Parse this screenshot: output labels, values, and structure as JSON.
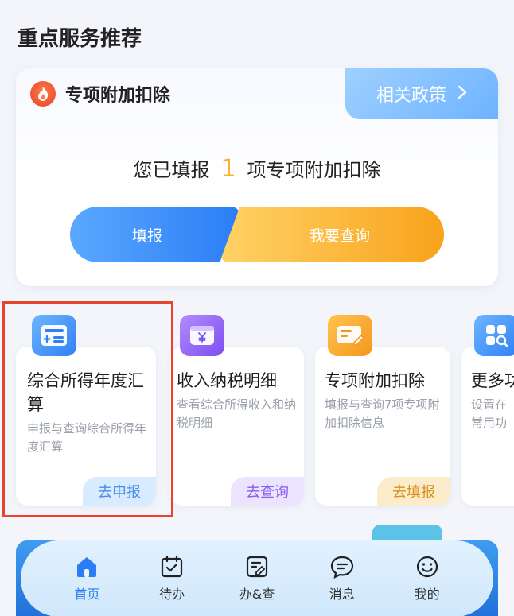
{
  "section": {
    "title": "重点服务推荐"
  },
  "deduction": {
    "title": "专项附加扣除",
    "policy_label": "相关政策",
    "filled_prefix": "您已填报",
    "filled_count": "1",
    "filled_suffix": "项专项附加扣除",
    "fill_button": "填报",
    "query_button": "我要查询"
  },
  "services": [
    {
      "title": "综合所得年度汇算",
      "desc": "申报与查询综合所得年度汇算",
      "action": "去申报",
      "icon": "tax-form-icon"
    },
    {
      "title": "收入纳税明细",
      "desc": "查看综合所得收入和纳税明细",
      "action": "去查询",
      "icon": "wallet-yen-icon"
    },
    {
      "title": "专项附加扣除",
      "desc": "填报与查询7项专项附加扣除信息",
      "action": "去填报",
      "icon": "card-edit-icon"
    },
    {
      "title": "更多功",
      "desc": "设置在常用功",
      "icon": "grid-search-icon"
    }
  ],
  "nav": [
    {
      "label": "首页",
      "icon": "home-icon",
      "active": true
    },
    {
      "label": "待办",
      "icon": "calendar-check-icon"
    },
    {
      "label": "办&查",
      "icon": "doc-edit-icon"
    },
    {
      "label": "消息",
      "icon": "chat-icon"
    },
    {
      "label": "我的",
      "icon": "smile-icon"
    }
  ],
  "colors": {
    "primary": "#2b7df6",
    "accent": "#f7b32b",
    "highlight": "#e8432e"
  }
}
